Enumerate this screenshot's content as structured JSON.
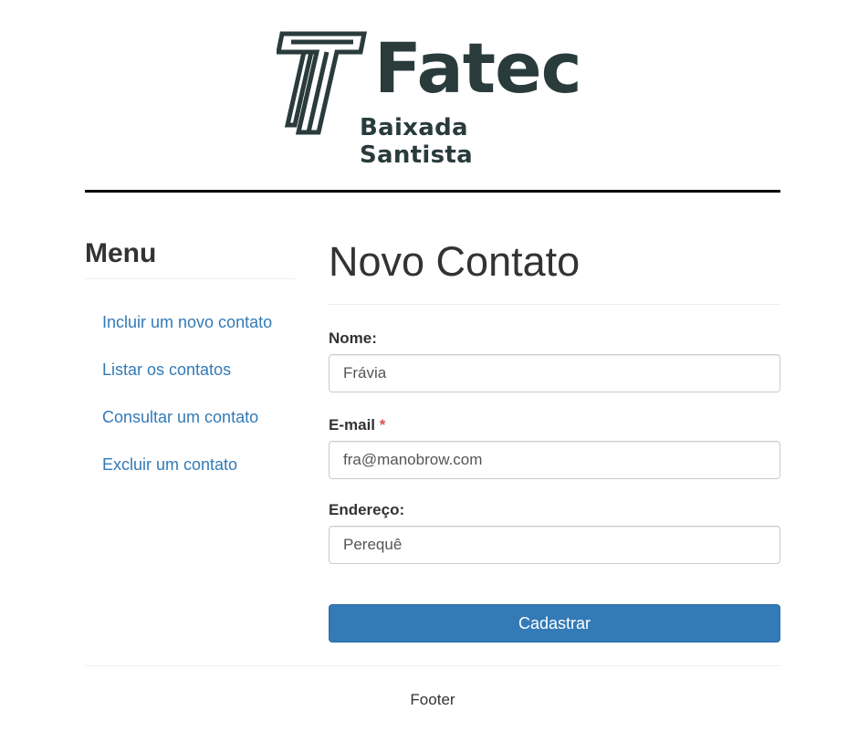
{
  "brand": {
    "name": "Fatec",
    "subtitle": "Baixada Santista",
    "logo_icon": "fatec-logo-mark",
    "color": "#2a3b3c"
  },
  "sidebar": {
    "title": "Menu",
    "items": [
      {
        "label": "Incluir um novo contato"
      },
      {
        "label": "Listar os contatos"
      },
      {
        "label": "Consultar um contato"
      },
      {
        "label": "Excluir um contato"
      }
    ],
    "link_color": "#337ab7"
  },
  "main": {
    "title": "Novo Contato",
    "form": {
      "name_label": "Nome:",
      "name_value": "Frávia",
      "email_label": "E-mail",
      "email_required": "*",
      "email_value": "fra@manobrow.com",
      "address_label": "Endereço:",
      "address_value": "Perequê",
      "submit_label": "Cadastrar"
    },
    "button_color": "#337ab7"
  },
  "footer": {
    "text": "Footer"
  }
}
